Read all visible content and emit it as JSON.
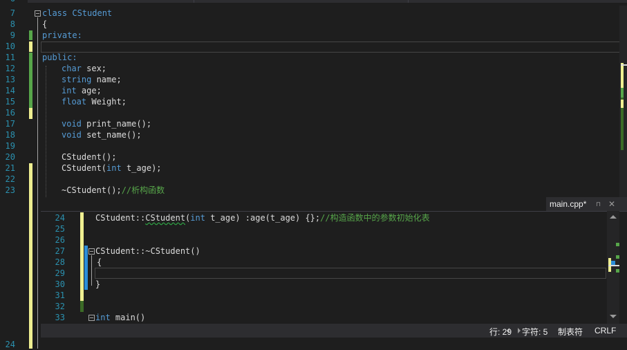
{
  "top_pane": {
    "lines": [
      {
        "n": "7"
      },
      {
        "n": "8"
      },
      {
        "n": "9"
      },
      {
        "n": "10"
      },
      {
        "n": "11"
      },
      {
        "n": "12"
      },
      {
        "n": "13"
      },
      {
        "n": "14"
      },
      {
        "n": "15"
      },
      {
        "n": "16"
      },
      {
        "n": "17"
      },
      {
        "n": "18"
      },
      {
        "n": "19"
      },
      {
        "n": "20"
      },
      {
        "n": "21"
      },
      {
        "n": "22"
      },
      {
        "n": "23"
      }
    ],
    "partial_line_number": "6",
    "bottom_line_number": "24",
    "code": {
      "l7_kw": "class",
      "l7_name": "CStudent",
      "l8": "{",
      "l9": "private:",
      "l10": "",
      "l11": "public:",
      "l12_kw": "char",
      "l12_rest": " sex;",
      "l13_kw": "string",
      "l13_rest": " name;",
      "l14_kw": "int",
      "l14_rest": " age;",
      "l15_kw": "float",
      "l15_rest": " Weight;",
      "l17_kw": "void",
      "l17_rest": " print_name();",
      "l18_kw": "void",
      "l18_rest": " set_name();",
      "l20": "CStudent();",
      "l21_a": "CStudent(",
      "l21_kw": "int",
      "l21_b": " t_age);",
      "l23_a": "~CStudent();",
      "l23_cm": "//析构函数"
    }
  },
  "bottom_pane": {
    "tab_label": "main.cpp*",
    "tab_pin": "⊓",
    "tab_close": "✕",
    "lines": [
      {
        "n": "24"
      },
      {
        "n": "25"
      },
      {
        "n": "26"
      },
      {
        "n": "27"
      },
      {
        "n": "28"
      },
      {
        "n": "29"
      },
      {
        "n": "30"
      },
      {
        "n": "31"
      },
      {
        "n": "32"
      },
      {
        "n": "33"
      }
    ],
    "code": {
      "l24_a": "CStudent::",
      "l24_sq": "CStudent",
      "l24_b": "(",
      "l24_kw": "int",
      "l24_c": " t_age) :age(t_age) {};",
      "l24_cm": "//构造函数中的参数初始化表",
      "l27_a": "CStudent::~CStudent()",
      "l28": "{",
      "l30": "}",
      "l33_kw": "int",
      "l33_rest": " main()"
    }
  },
  "status": {
    "line": "行: 29",
    "col": "字符: 5",
    "tab": "制表符",
    "eol": "CRLF"
  },
  "colors": {
    "background": "#1e1e1e",
    "line_number": "#2b91af",
    "keyword": "#569cd6",
    "comment": "#57a64a",
    "saved_change": "#57a64a",
    "unsaved_change": "#efef91",
    "status_bar": "#2d2d30"
  }
}
